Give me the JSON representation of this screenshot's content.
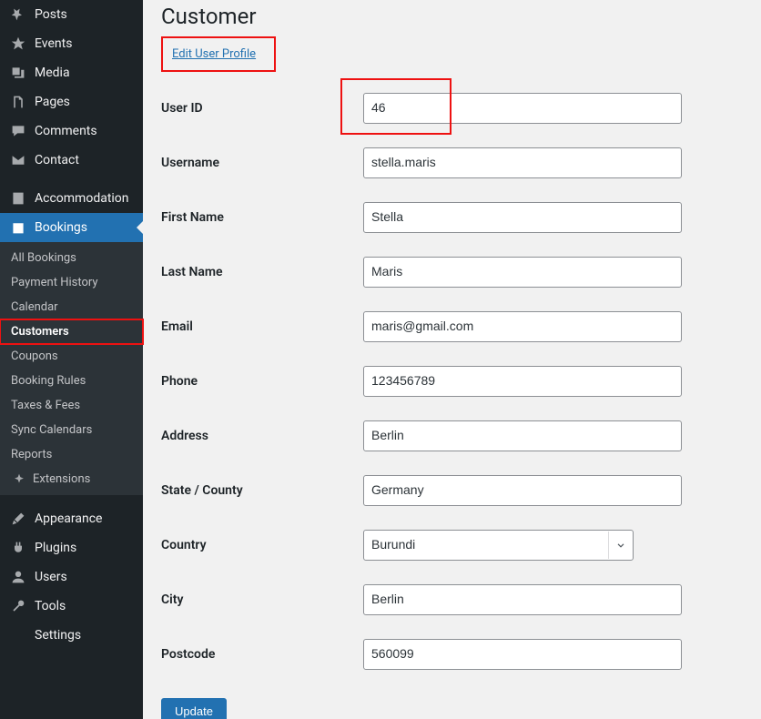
{
  "sidebar": {
    "top": [
      {
        "label": "Posts",
        "icon": "pushpin"
      },
      {
        "label": "Events",
        "icon": "star"
      },
      {
        "label": "Media",
        "icon": "media"
      },
      {
        "label": "Pages",
        "icon": "page"
      },
      {
        "label": "Comments",
        "icon": "comment"
      },
      {
        "label": "Contact",
        "icon": "mail"
      }
    ],
    "accommodation": {
      "label": "Accommodation",
      "icon": "building"
    },
    "bookings": {
      "label": "Bookings",
      "icon": "calendar"
    },
    "booking_submenu": [
      {
        "label": "All Bookings"
      },
      {
        "label": "Payment History"
      },
      {
        "label": "Calendar"
      },
      {
        "label": "Customers",
        "current": true
      },
      {
        "label": "Coupons"
      },
      {
        "label": "Booking Rules"
      },
      {
        "label": "Taxes & Fees"
      },
      {
        "label": "Sync Calendars"
      },
      {
        "label": "Reports"
      },
      {
        "label": "Extensions",
        "ext": true,
        "icon": "sparkle"
      }
    ],
    "bottom": [
      {
        "label": "Appearance",
        "icon": "brush"
      },
      {
        "label": "Plugins",
        "icon": "plug"
      },
      {
        "label": "Users",
        "icon": "user"
      },
      {
        "label": "Tools",
        "icon": "wrench"
      },
      {
        "label": "Settings",
        "icon": "sliders"
      }
    ]
  },
  "page": {
    "title": "Customer",
    "edit_link": "Edit User Profile",
    "update_button": "Update"
  },
  "form": {
    "user_id": {
      "label": "User ID",
      "value": "46"
    },
    "username": {
      "label": "Username",
      "value": "stella.maris"
    },
    "first_name": {
      "label": "First Name",
      "value": "Stella"
    },
    "last_name": {
      "label": "Last Name",
      "value": "Maris"
    },
    "email": {
      "label": "Email",
      "value": "maris@gmail.com"
    },
    "phone": {
      "label": "Phone",
      "value": "123456789"
    },
    "address": {
      "label": "Address",
      "value": "Berlin"
    },
    "state": {
      "label": "State / County",
      "value": "Germany"
    },
    "country": {
      "label": "Country",
      "value": "Burundi"
    },
    "city": {
      "label": "City",
      "value": "Berlin"
    },
    "postcode": {
      "label": "Postcode",
      "value": "560099"
    }
  }
}
